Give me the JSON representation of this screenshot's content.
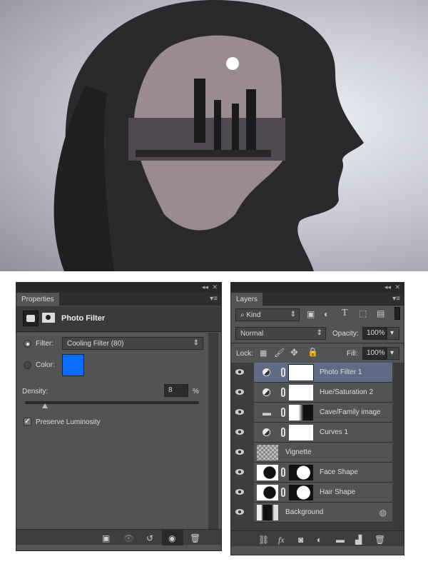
{
  "properties": {
    "tab": "Properties",
    "title": "Photo Filter",
    "filter_label": "Filter:",
    "filter_value": "Cooling Filter (80)",
    "color_label": "Color:",
    "color_swatch": "#0a6cff",
    "density_label": "Density:",
    "density_value": "8",
    "density_unit": "%",
    "density_fraction": 0.08,
    "preserve_label": "Preserve Luminosity",
    "preserve_checked": true
  },
  "layers": {
    "tab": "Layers",
    "kind": "Kind",
    "blend_mode": "Normal",
    "opacity_label": "Opacity:",
    "opacity_value": "100%",
    "lock_label": "Lock:",
    "fill_label": "Fill:",
    "fill_value": "100%",
    "items": [
      {
        "name": "Photo Filter 1"
      },
      {
        "name": "Hue/Saturation 2"
      },
      {
        "name": "Cave/Family image"
      },
      {
        "name": "Curves 1"
      },
      {
        "name": "Vignette"
      },
      {
        "name": "Face Shape"
      },
      {
        "name": "Hair Shape"
      },
      {
        "name": "Background"
      }
    ]
  }
}
